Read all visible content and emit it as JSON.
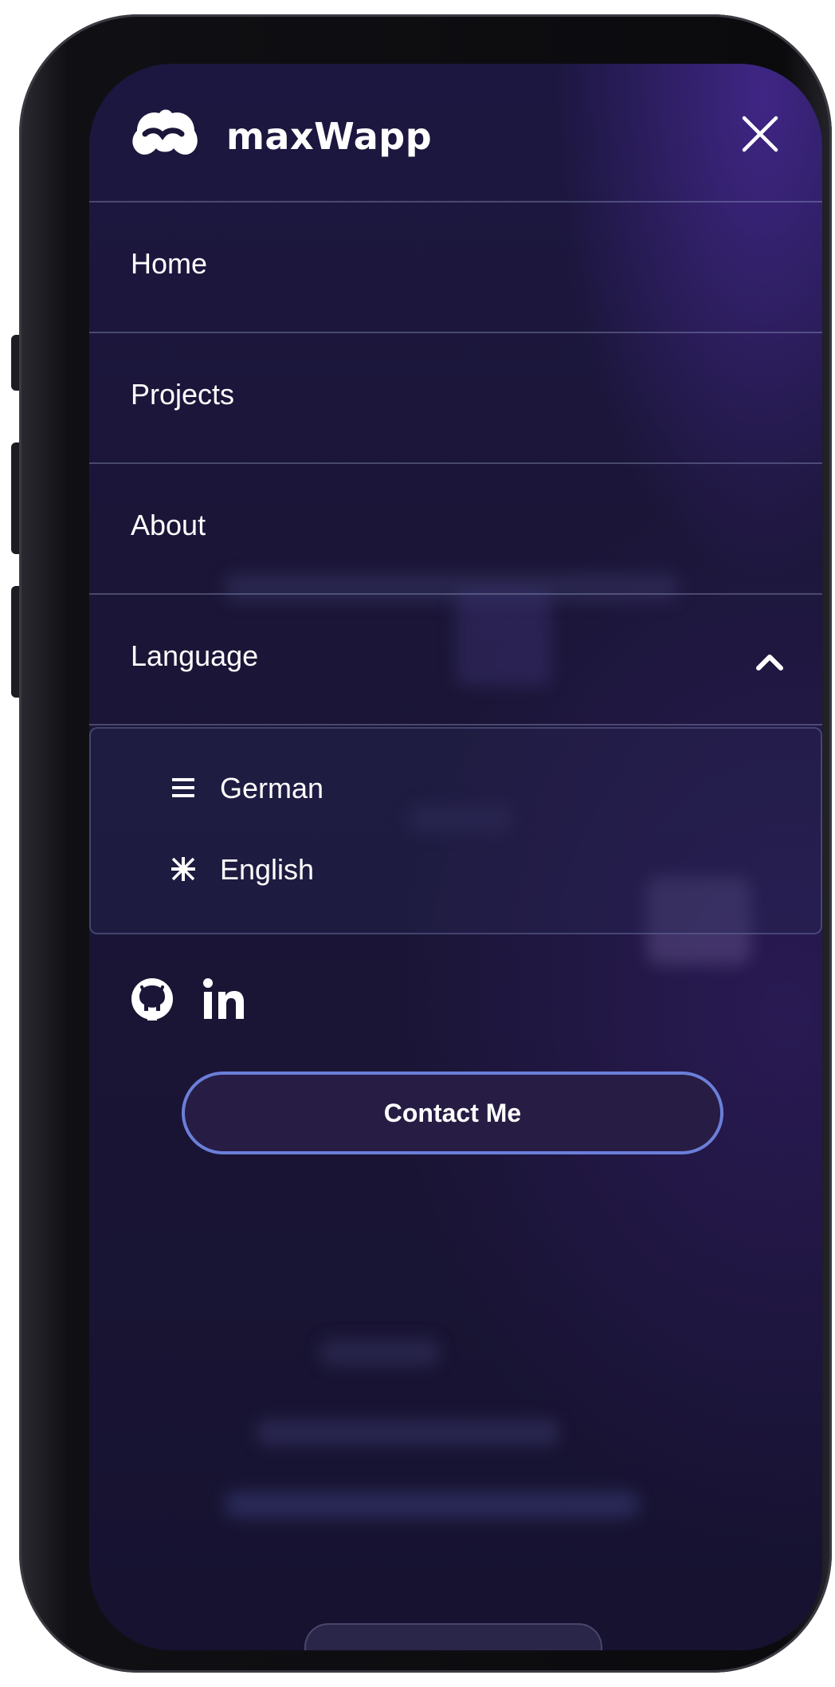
{
  "app": {
    "brand": "maxWapp"
  },
  "header": {
    "logo_icon": "mustache-cloud-logo",
    "close_icon": "close-icon"
  },
  "nav": {
    "items": [
      {
        "label": "Home"
      },
      {
        "label": "Projects"
      },
      {
        "label": "About"
      },
      {
        "label": "Language",
        "expanded": true
      }
    ]
  },
  "language_menu": {
    "options": [
      {
        "label": "German",
        "icon": "horizontal-stripes-icon"
      },
      {
        "label": "English",
        "icon": "union-jack-icon"
      }
    ]
  },
  "social": {
    "github_icon": "github-icon",
    "linkedin_icon": "linkedin-icon"
  },
  "cta": {
    "label": "Contact Me"
  },
  "colors": {
    "background": "#1b1638",
    "accent_border": "#6b7fd9",
    "button_fill": "#271c44",
    "text": "#ffffff",
    "divider": "#5a5f85"
  }
}
